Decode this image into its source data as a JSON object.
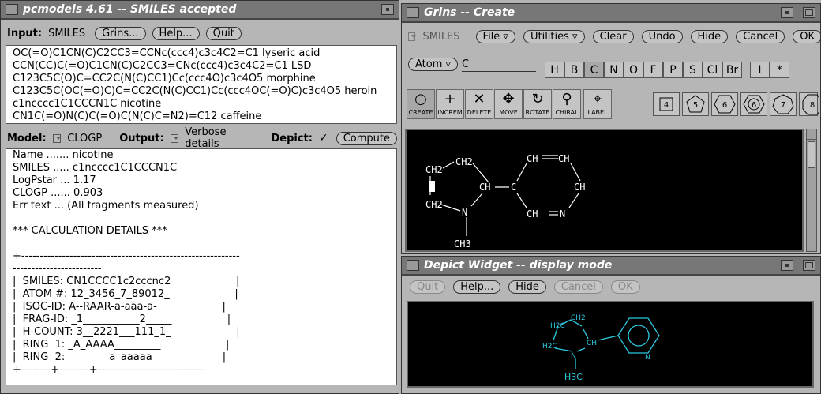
{
  "pcmodels": {
    "title": "pcmodels 4.61 -- SMILES accepted",
    "input_label": "Input:",
    "input_value": "SMILES",
    "grins_btn": "Grins...",
    "help_btn": "Help...",
    "quit_btn": "Quit",
    "smiles_lines": [
      "OC(=O)C1CN(C)C2CC3=CCNc(ccc4)c3c4C2=C1 lyseric acid",
      "CCN(CC)C(=O)C1CN(C)C2CC3=CNc(ccc4)c3c4C2=C1 LSD",
      "C123C5C(O)C=CC2C(N(C)CC1)Cc(ccc4O)c3c4O5 morphine",
      "C123C5C(OC(=O)C)C=CC2C(N(C)CC1)Cc(ccc4OC(=O)C)c3c4O5 heroin",
      "c1ncccc1C1CCCN1C nicotine",
      "CN1C(=O)N(C)C(=O)C(N(C)C=N2)=C12 caffeine"
    ],
    "model_label": "Model:",
    "model_value": "CLOGP",
    "output_label": "Output:",
    "output_value": "Verbose details",
    "depict_label": "Depict:",
    "depict_check": "✓",
    "compute_btn": "Compute",
    "output_lines": [
      "Name ....... nicotine",
      "SMILES ..... c1ncccc1C1CCCN1C",
      "LogPstar ... 1.17",
      "CLOGP ...... 0.903",
      "Err text ... (All fragments measured)",
      "",
      "*** CALCULATION DETAILS ***",
      "",
      "+-----------------------------------------------------------",
      "------------------------",
      "|  SMILES: CN1CCCC1c2cccnc2                    |",
      "|  ATOM #: 12_3456_7_89012_                    |",
      "|  ISOC-ID: A--RAAR-a-aaa-a-                    |",
      "|  FRAG-ID: _1___________2_____                 |",
      "|  H-COUNT: 3__2221___111_1_                    |",
      "|  RING  1: _A_AAAA_________                    |",
      "|  RING  2: ________a_aaaaa_                    |",
      "+--------+--------+-----------------------------"
    ]
  },
  "grins": {
    "title": "Grins -- Create",
    "smiles_label": "SMILES",
    "file_menu": "File",
    "utilities_menu": "Utilities",
    "clear_btn": "Clear",
    "undo_btn": "Undo",
    "hide_btn": "Hide",
    "cancel_btn": "Cancel",
    "ok_btn": "OK",
    "atom_menu": "Atom",
    "atom_input": "C",
    "atoms": [
      "H",
      "B",
      "C",
      "N",
      "O",
      "F",
      "P",
      "S",
      "Cl",
      "Br",
      "I",
      "*"
    ],
    "tools": [
      {
        "glyph": "○",
        "label": "CREATE"
      },
      {
        "glyph": "+",
        "label": "INCREM"
      },
      {
        "glyph": "✕",
        "label": "DELETE"
      },
      {
        "glyph": "✥",
        "label": "MOVE"
      },
      {
        "glyph": "↻",
        "label": "ROTATE"
      },
      {
        "glyph": "⚲",
        "label": "CHIRAL"
      },
      {
        "glyph": "⌖",
        "label": "LABEL"
      }
    ],
    "rings": [
      "4",
      "5",
      "6",
      "6",
      "7",
      "8"
    ],
    "mol": {
      "ch2_a": "CH2",
      "ch2_b": "CH2",
      "ch2_c": "CH2",
      "ch_center": "CH",
      "c_ring": "C",
      "ch_1": "CH",
      "ch_2": "CH",
      "ch_3": "CH",
      "ch_4": "CH",
      "n_ring": "N",
      "n_pyr": "N",
      "ch3": "CH3"
    }
  },
  "depict": {
    "title": "Depict Widget -- display mode",
    "quit_btn": "Quit",
    "help_btn": "Help...",
    "hide_btn": "Hide",
    "cancel_btn": "Cancel",
    "ok_btn": "OK",
    "mol": {
      "ch2_top": "CH2",
      "h2c_a": "H2C",
      "h2c_b": "H2C",
      "ch": "CH",
      "n": "N",
      "n_pyr": "N",
      "h3c": "H3C"
    }
  }
}
